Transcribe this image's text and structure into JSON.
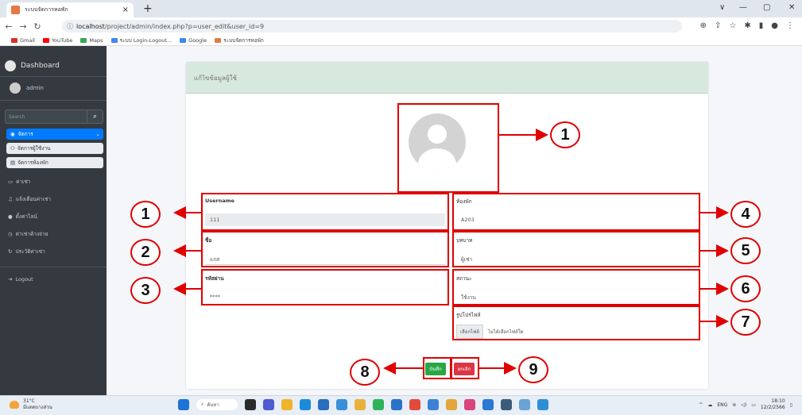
{
  "browser": {
    "tab_title": "ระบบจัดการหอพัก",
    "tab_close": "×",
    "new_tab": "+",
    "url_host": "localhost",
    "url_path": "/project/admin/index.php?p=user_edit&user_id=9",
    "win_controls": [
      "∨",
      "—",
      "▢",
      "✕"
    ],
    "bookmarks": [
      {
        "label": "Gmail",
        "color": "#d93025"
      },
      {
        "label": "YouTube",
        "color": "#ff0000"
      },
      {
        "label": "Maps",
        "color": "#34a853"
      },
      {
        "label": "ระบบ Login-Logout...",
        "color": "#4285f4"
      },
      {
        "label": "Google",
        "color": "#4285f4"
      },
      {
        "label": "ระบบจัดการหอพัก",
        "color": "#e37a45"
      }
    ]
  },
  "sidebar": {
    "brand": "Dashboard",
    "user": "admin",
    "search_placeholder": "Search",
    "active_menu": "จัดการ",
    "submenu": [
      "จัดการผู้ใช้งาน",
      "จัดการห้องพัก"
    ],
    "items": [
      "ค่าเช่า",
      "แจ้งเตือนค่าเช่า",
      "ตั้งค่าไลน์",
      "ค่าเช่าค้างจ่าย",
      "ประวัติค่าเช่า"
    ],
    "logout": "Logout"
  },
  "form": {
    "title": "แก้ไขข้อมูลผู้ใช้",
    "username_label": "Username",
    "username_value": "111",
    "name_label": "ชื่อ",
    "name_value": "แกส",
    "password_label": "รหัสผ่าน",
    "password_value": "****",
    "room_label": "ห้องพัก",
    "room_value": "A203",
    "role_label": "บทบาท",
    "role_value": "ผู้เช่า",
    "status_label": "สถานะ",
    "status_value": "ใช้งาน",
    "photo_label": "รูปโปรไฟล์",
    "choose_file": "เลือกไฟล์",
    "no_file": "ไม่ได้เลือกไฟล์ใด",
    "save": "บันทึก",
    "cancel": "ยกเลิก"
  },
  "annotations": [
    "1",
    "1",
    "2",
    "3",
    "4",
    "5",
    "6",
    "7",
    "8",
    "9"
  ],
  "taskbar": {
    "temp": "31°C",
    "weather": "มีแดดบางส่วน",
    "search": "ค้นหา",
    "lang": "ENG",
    "time": "18:10",
    "date": "12/2/2566"
  },
  "colors": {
    "accent": "#007bff",
    "annotation": "#e00000",
    "save": "#28a745",
    "cancel": "#dc3545"
  }
}
